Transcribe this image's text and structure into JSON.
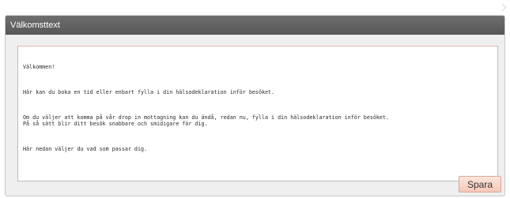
{
  "panel": {
    "title": "Välkomsttext"
  },
  "editor": {
    "lines": [
      "Välkommen!",
      "Här kan du boka en tid eller enbart fylla i din hälsodeklaration inför besöket.",
      "Om du väljer att komma på vår drop in mottagning kan du ändå, redan nu, fylla i din hälsodeklaration inför besöket.\nPå så sätt blir ditt besök snabbare och smidigare för dig.",
      "Här nedan väljer du vad som passar dig."
    ]
  },
  "actions": {
    "save_label": "Spara"
  }
}
